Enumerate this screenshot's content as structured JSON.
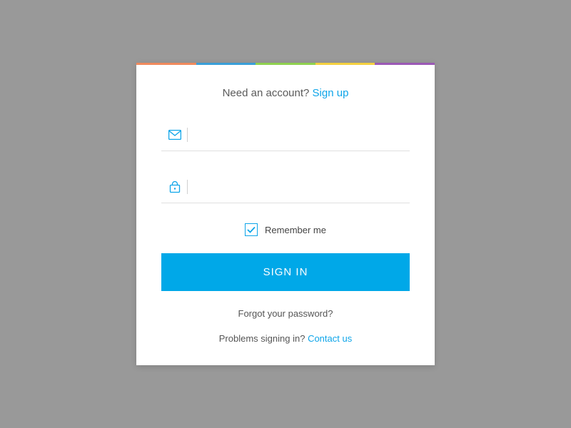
{
  "header": {
    "prompt": "Need an account? ",
    "signup_link": "Sign up"
  },
  "form": {
    "email": {
      "value": "",
      "placeholder": ""
    },
    "password": {
      "value": "",
      "placeholder": ""
    },
    "remember": {
      "checked": true,
      "label": "Remember me"
    },
    "submit_label": "SIGN IN"
  },
  "footer": {
    "forgot": "Forgot your password?",
    "problems_prompt": "Problems signing in? ",
    "contact_link": "Contact us"
  },
  "colors": {
    "accent": "#00a8e8",
    "stripe": [
      "#f08a5d",
      "#3a9fd8",
      "#8fd14f",
      "#f4d03f",
      "#9b59b6"
    ]
  }
}
